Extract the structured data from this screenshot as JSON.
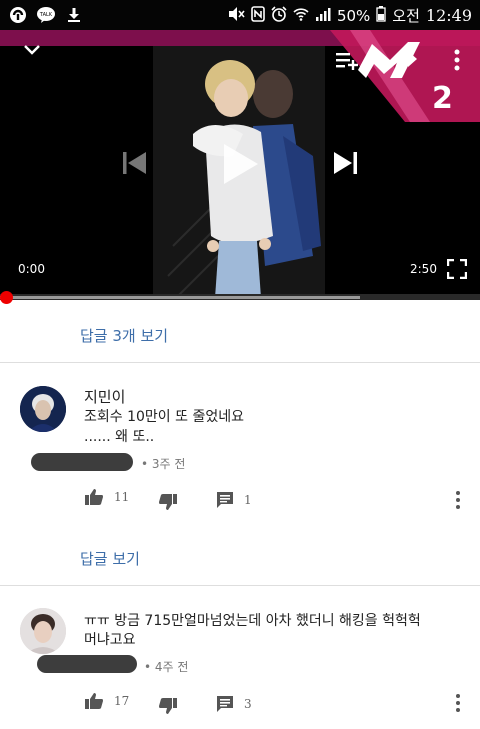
{
  "statusbar": {
    "battery": "50%",
    "period": "오전",
    "time": "12:49"
  },
  "player": {
    "current_time": "0:00",
    "duration": "2:50",
    "progress_fraction": 0.0,
    "buffered_fraction": 0.75,
    "logo_text": "2"
  },
  "thread1": {
    "view_replies": "답글 3개 보기"
  },
  "comment1": {
    "author": "지민이",
    "line1": "조회수 10만이 또 줄었네요",
    "line2": "...... 왜 또..",
    "ago": "3주 전",
    "likes": "11",
    "replies": "1"
  },
  "thread2": {
    "view_replies": "답글 보기"
  },
  "comment2": {
    "line1": "ㅠㅠ 방금 715만얼마넘었는데 아차 했더니 해킹을 헉헉헉",
    "line2": "머냐고요",
    "ago": "4주 전",
    "likes": "17",
    "replies": "3"
  },
  "colors": {
    "accent_pink": "#c2185b",
    "link_blue": "#3e6ea9",
    "progress_red": "#ee0000"
  }
}
